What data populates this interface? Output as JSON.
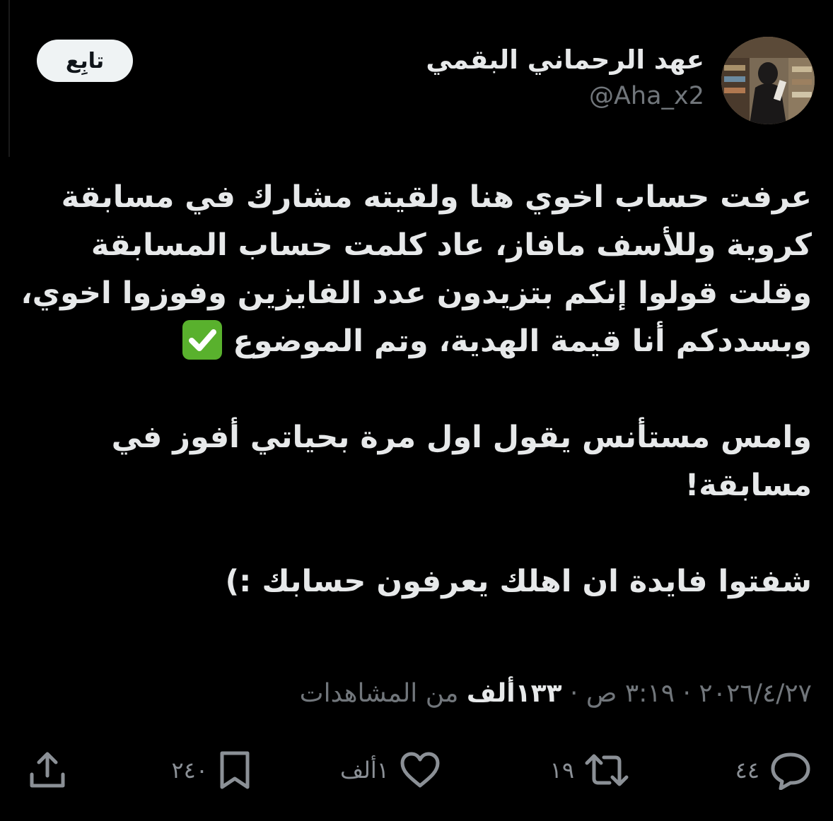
{
  "author": {
    "name": "عهد الرحماني البقمي",
    "handle": "@Aha_x2"
  },
  "follow_button": {
    "label": "تابِع"
  },
  "tweet": {
    "paragraph_1": "عرفت حساب اخوي هنا ولقيته مشارك في مسابقة كروية وللأسف مافاز، عاد كلمت حساب المسابقة وقلت قولوا إنكم بتزيدون عدد الفايزين وفوزوا اخوي، وبسددكم أنا قيمة الهدية، وتم الموضوع",
    "paragraph_1_emoji": "check-mark-button",
    "paragraph_2": "وامس مستأنس يقول اول مرة بحياتي أفوز في مسابقة!",
    "paragraph_3": "شفتوا فايدة ان اهلك يعرفون حسابك :)"
  },
  "meta": {
    "time": "٣:١٩ ص",
    "separator": "·",
    "date": "٢٠٢٦/٤/٢٧",
    "views_count": "١٣٣ألف",
    "views_label": "من المشاهدات"
  },
  "actions": {
    "replies": {
      "icon": "reply-icon",
      "count": "٤٤"
    },
    "reposts": {
      "icon": "repost-icon",
      "count": "١٩"
    },
    "likes": {
      "icon": "heart-icon",
      "count": "١ألف"
    },
    "bookmarks": {
      "icon": "bookmark-icon",
      "count": "٢٤٠"
    },
    "share": {
      "icon": "share-icon"
    }
  },
  "colors": {
    "background": "#000000",
    "primary_text": "#e7e9ea",
    "secondary_text": "#71767b",
    "follow_bg": "#eff3f4",
    "check_green": "#59b12d"
  }
}
